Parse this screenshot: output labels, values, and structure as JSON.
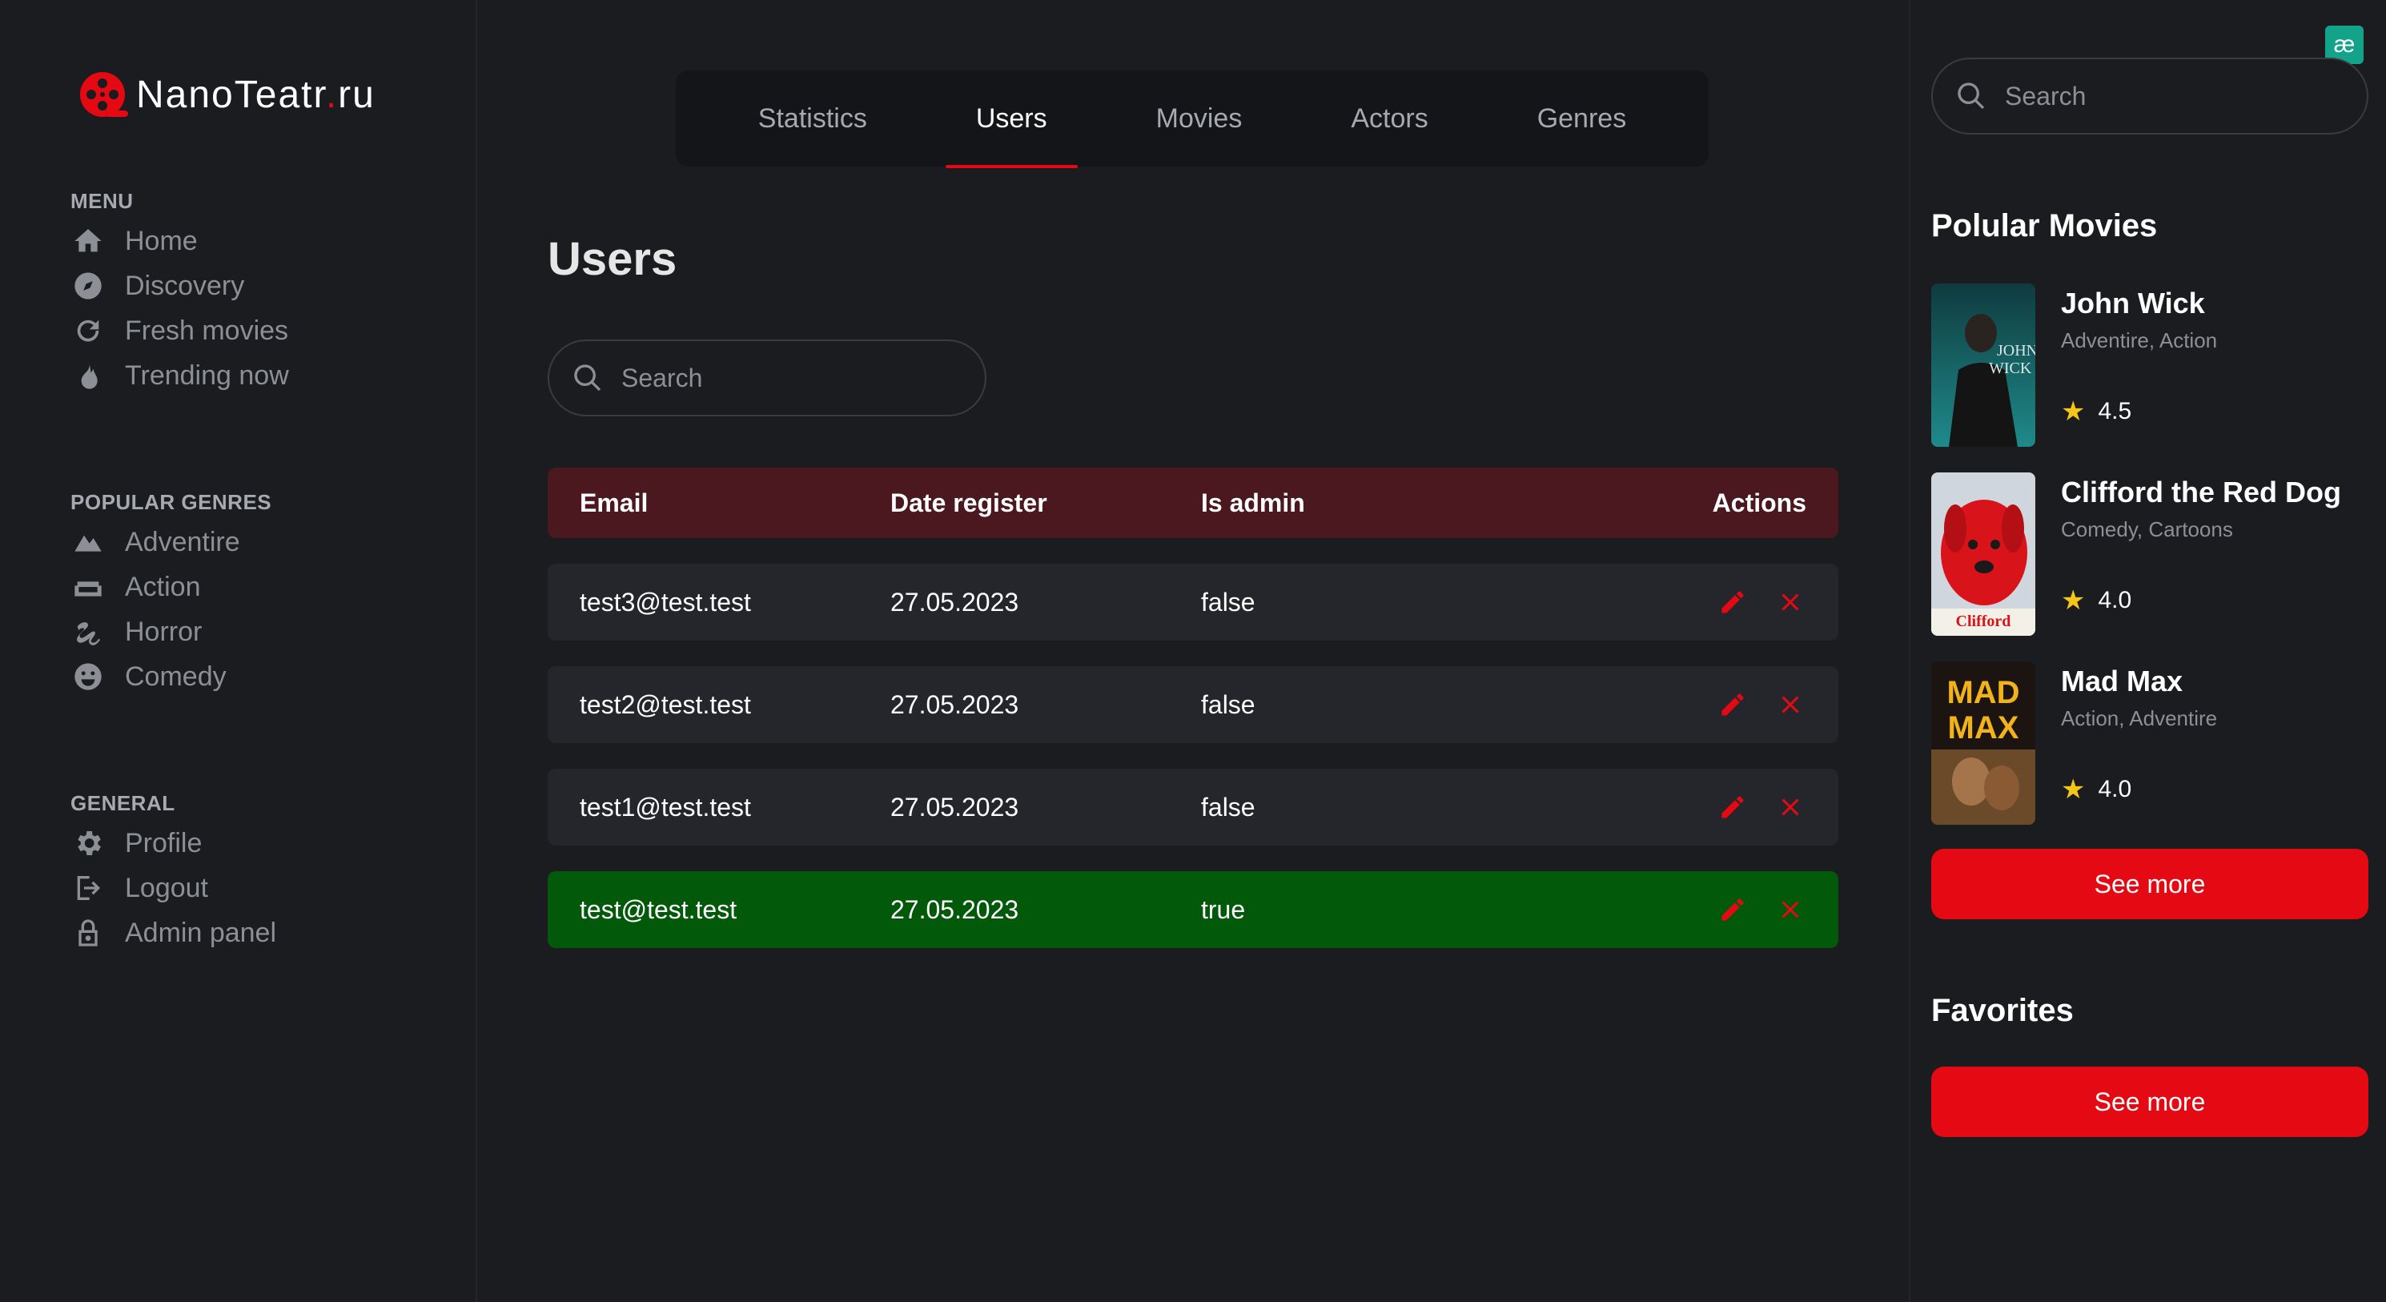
{
  "brand": {
    "name": "NanoTeatr",
    "dot": ".",
    "tld": "ru",
    "accent": "#e50914"
  },
  "sidebar": {
    "menu": {
      "heading": "MENU",
      "items": [
        {
          "label": "Home",
          "icon": "home-icon"
        },
        {
          "label": "Discovery",
          "icon": "compass-icon"
        },
        {
          "label": "Fresh movies",
          "icon": "refresh-icon"
        },
        {
          "label": "Trending now",
          "icon": "flame-icon"
        }
      ]
    },
    "genres": {
      "heading": "POPULAR GENRES",
      "items": [
        {
          "label": "Adventire",
          "icon": "mountain-icon"
        },
        {
          "label": "Action",
          "icon": "couch-icon"
        },
        {
          "label": "Horror",
          "icon": "scribble-icon"
        },
        {
          "label": "Comedy",
          "icon": "smile-icon"
        }
      ]
    },
    "general": {
      "heading": "GENERAL",
      "items": [
        {
          "label": "Profile",
          "icon": "gear-icon"
        },
        {
          "label": "Logout",
          "icon": "logout-icon"
        },
        {
          "label": "Admin panel",
          "icon": "lock-icon"
        }
      ]
    }
  },
  "tabs": [
    {
      "label": "Statistics",
      "active": false
    },
    {
      "label": "Users",
      "active": true
    },
    {
      "label": "Movies",
      "active": false
    },
    {
      "label": "Actors",
      "active": false
    },
    {
      "label": "Genres",
      "active": false
    }
  ],
  "main": {
    "title": "Users",
    "search_placeholder": "Search",
    "columns": {
      "email": "Email",
      "date": "Date register",
      "admin": "Is admin",
      "actions": "Actions"
    },
    "rows": [
      {
        "email": "test3@test.test",
        "date": "27.05.2023",
        "is_admin": "false"
      },
      {
        "email": "test2@test.test",
        "date": "27.05.2023",
        "is_admin": "false"
      },
      {
        "email": "test1@test.test",
        "date": "27.05.2023",
        "is_admin": "false"
      },
      {
        "email": "test@test.test",
        "date": "27.05.2023",
        "is_admin": "true"
      }
    ],
    "admin_row_color": "#03590a",
    "header_color": "#4a181e"
  },
  "right": {
    "search_placeholder": "Search",
    "ext_icon": "æ",
    "popular_title": "Polular Movies",
    "movies": [
      {
        "title": "John Wick",
        "genres": "Adventire, Action",
        "rating": "4.5"
      },
      {
        "title": "Clifford the Red Dog",
        "genres": "Comedy, Cartoons",
        "rating": "4.0"
      },
      {
        "title": "Mad Max",
        "genres": "Action, Adventire",
        "rating": "4.0"
      }
    ],
    "see_more": "See more",
    "favorites_title": "Favorites",
    "favorites_see_more": "See more"
  }
}
